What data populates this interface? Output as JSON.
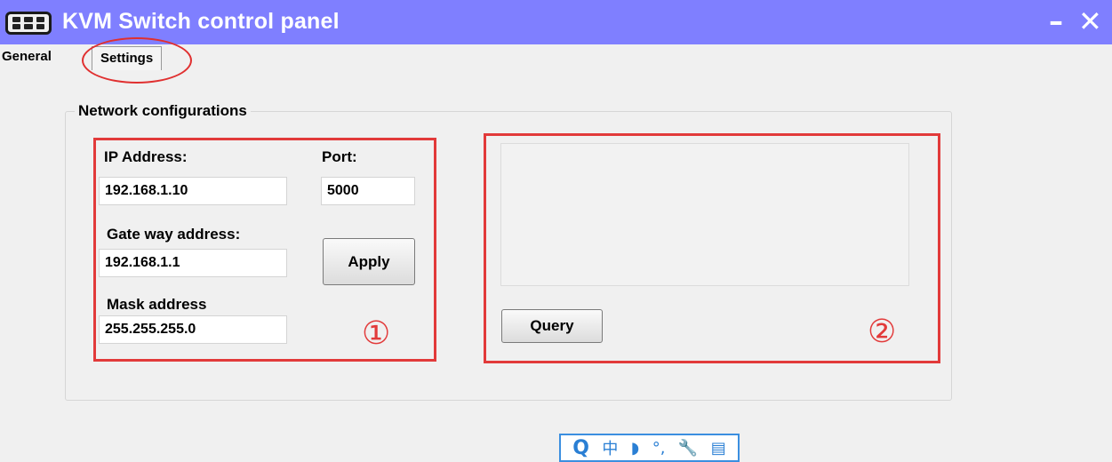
{
  "window": {
    "title": "KVM Switch control panel",
    "minimize_glyph": "–",
    "close_glyph": "✕",
    "accent_color": "#7f7fff"
  },
  "tabs": [
    {
      "label": "General",
      "selected": false
    },
    {
      "label": "Settings",
      "selected": true
    }
  ],
  "network": {
    "group_title": "Network configurations",
    "ip_label": "IP Address:",
    "ip_value": "192.168.1.10",
    "port_label": "Port:",
    "port_value": "5000",
    "gateway_label": "Gate way address:",
    "gateway_value": "192.168.1.1",
    "mask_label": "Mask address",
    "mask_value": "255.255.255.0",
    "apply_label": "Apply",
    "annotation_1": "①"
  },
  "query": {
    "output_value": "",
    "query_label": "Query",
    "annotation_2": "②"
  },
  "ime_toolbar": {
    "search_glyph": "Q",
    "chinese_glyph": "中",
    "moon_glyph": "◗",
    "punct_glyph": "°,",
    "wrench_glyph": "🔧",
    "clipboard_glyph": "▤"
  },
  "annotation_color": "#e23a3a"
}
